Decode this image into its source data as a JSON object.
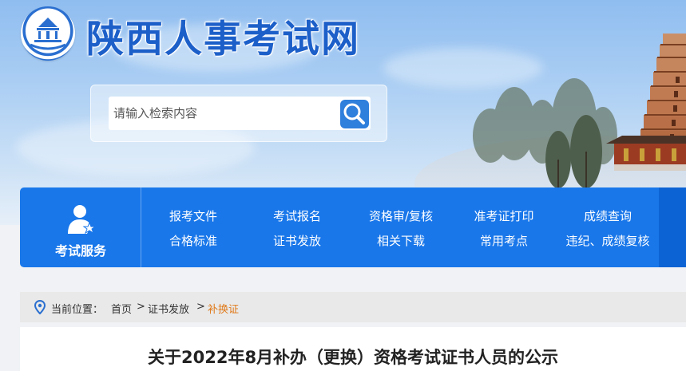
{
  "header": {
    "site_title": "陕西人事考试网",
    "logo_icon": "tower-emblem-icon"
  },
  "search": {
    "placeholder": "请输入检索内容",
    "button_icon": "search-icon"
  },
  "nav": {
    "section_label": "考试服务",
    "section_icon": "user-star-icon",
    "row1": [
      "报考文件",
      "考试报名",
      "资格审/复核",
      "准考证打印",
      "成绩查询"
    ],
    "row2": [
      "合格标准",
      "证书发放",
      "相关下载",
      "常用考点",
      "违纪、成绩复核"
    ]
  },
  "breadcrumb": {
    "prefix": "当前位置：",
    "home": "首页",
    "sep1": ">",
    "section": "证书发放",
    "sep2": ">",
    "current": "补换证",
    "icon": "location-pin-icon"
  },
  "article": {
    "title": "关于2022年8月补办（更换）资格考试证书人员的公示"
  },
  "colors": {
    "brand_blue": "#1977ea",
    "title_blue": "#1c5fc9",
    "breadcrumb_current": "#e07a1a"
  }
}
